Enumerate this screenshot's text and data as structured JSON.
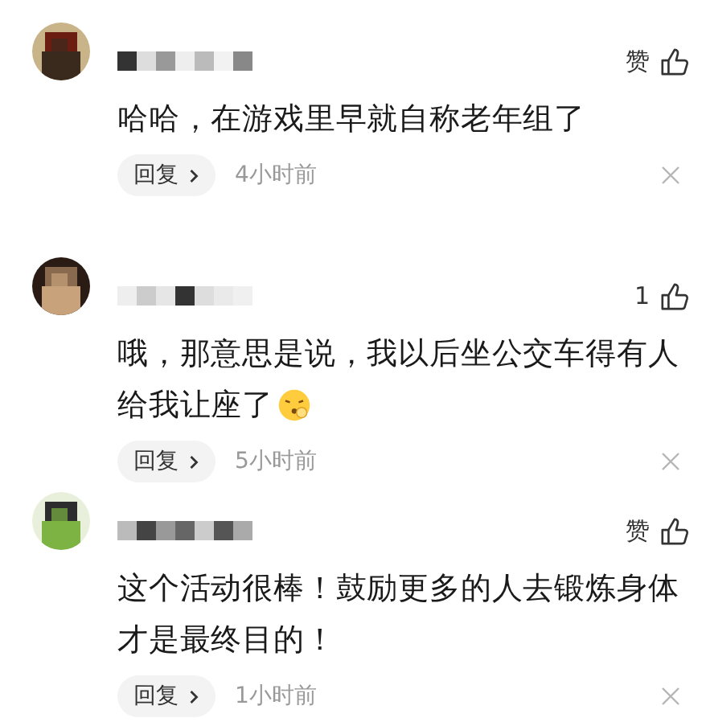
{
  "comments": [
    {
      "like_label": "赞",
      "lines": [
        "哈哈，在游戏里早就自称老年组了"
      ],
      "emoji": false,
      "reply": "回复",
      "time": "4小时前"
    },
    {
      "like_label": "1",
      "lines": [
        "哦，那意思是说，我以后坐公交车得有人",
        "给我让座了"
      ],
      "emoji": true,
      "reply": "回复",
      "time": "5小时前"
    },
    {
      "like_label": "赞",
      "lines": [
        "这个活动很棒！鼓励更多的人去锻炼身体",
        "才是最终目的！"
      ],
      "emoji": false,
      "reply": "回复",
      "time": "1小时前"
    }
  ]
}
